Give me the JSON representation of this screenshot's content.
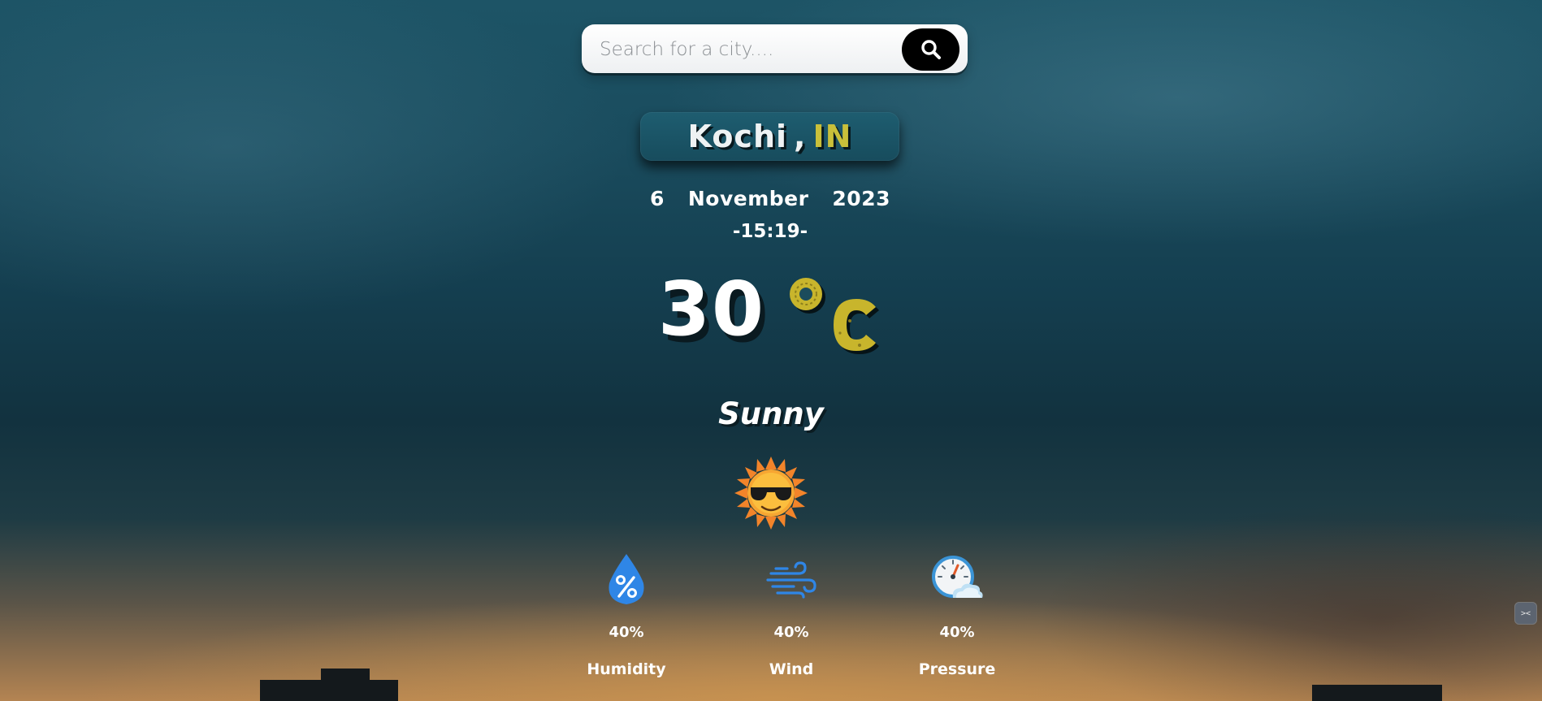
{
  "search": {
    "placeholder": "Search for a city....",
    "button_icon": "search-icon"
  },
  "location": {
    "city": "Kochi",
    "separator": ",",
    "country": "IN"
  },
  "date": {
    "day": "6",
    "month": "November",
    "year": "2023"
  },
  "time": "-15:19-",
  "temperature": {
    "value": "30",
    "unit_icon": "degree-celsius-icon"
  },
  "condition": {
    "text": "Sunny",
    "icon": "sun-with-sunglasses-icon"
  },
  "stats": [
    {
      "icon": "humidity-drop-icon",
      "value": "40%",
      "label": "Humidity"
    },
    {
      "icon": "wind-icon",
      "value": "40%",
      "label": "Wind"
    },
    {
      "icon": "pressure-gauge-icon",
      "value": "40%",
      "label": "Pressure"
    }
  ],
  "colors": {
    "accent_yellow": "#c9c03a",
    "city_box": "#1b5466",
    "search_button": "#000000",
    "icon_blue": "#2f86e6"
  },
  "side_widget_icon": "dev-tools-icon"
}
